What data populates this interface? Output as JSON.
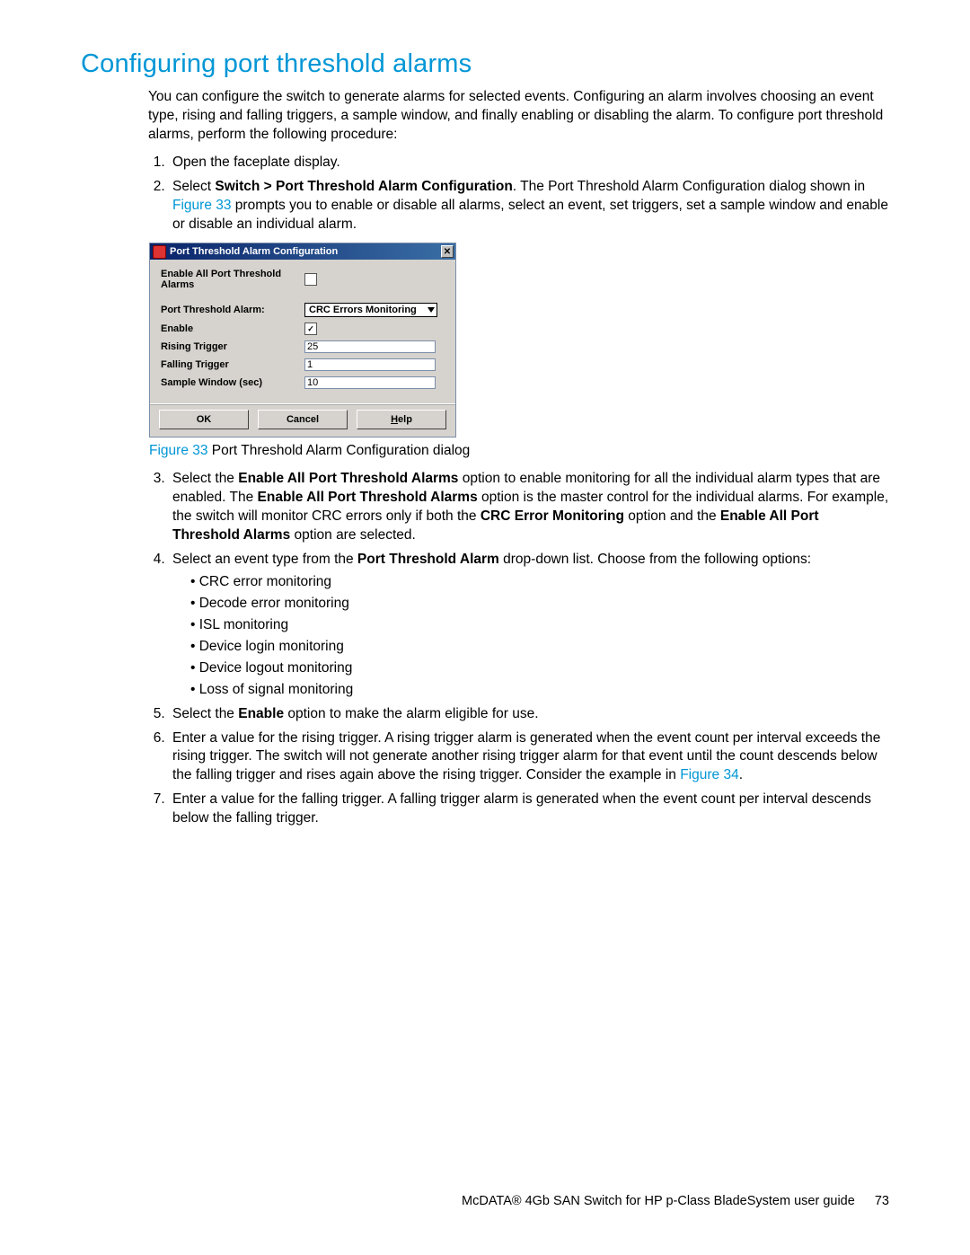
{
  "heading": "Configuring port threshold alarms",
  "intro": "You can configure the switch to generate alarms for selected events. Configuring an alarm involves choosing an event type, rising and falling triggers, a sample window, and finally enabling or disabling the alarm. To configure port threshold alarms, perform the following procedure:",
  "steps": {
    "s1": "Open the faceplate display.",
    "s2a": "Select ",
    "s2b": "Switch > Port Threshold Alarm Configuration",
    "s2c": ". The Port Threshold Alarm Configuration dialog shown in ",
    "s2d": "Figure 33",
    "s2e": " prompts you to enable or disable all alarms, select an event, set triggers, set a sample window and enable or disable an individual alarm.",
    "s3a": "Select the ",
    "s3b": "Enable All Port Threshold Alarms",
    "s3c": " option to enable monitoring for all the individual alarm types that are enabled. The ",
    "s3d": "Enable All Port Threshold Alarms",
    "s3e": " option is the master control for the individual alarms. For example, the switch will monitor CRC errors only if both the ",
    "s3f": "CRC Error Monitoring",
    "s3g": " option and the ",
    "s3h": "Enable All Port Threshold Alarms",
    "s3i": " option are selected.",
    "s4a": "Select an event type from the ",
    "s4b": "Port Threshold Alarm",
    "s4c": " drop-down list. Choose from the following options:",
    "opt1": "CRC error monitoring",
    "opt2": "Decode error monitoring",
    "opt3": "ISL monitoring",
    "opt4": "Device login monitoring",
    "opt5": "Device logout monitoring",
    "opt6": "Loss of signal monitoring",
    "s5a": "Select the ",
    "s5b": "Enable",
    "s5c": " option to make the alarm eligible for use.",
    "s6a": "Enter a value for the rising trigger. A rising trigger alarm is generated when the event count per interval exceeds the rising trigger. The switch will not generate another rising trigger alarm for that event until the count descends below the falling trigger and rises again above the rising trigger. Consider the example in ",
    "s6b": "Figure 34",
    "s6c": ".",
    "s7": "Enter a value for the falling trigger. A falling trigger alarm is generated when the event count per interval descends below the falling trigger."
  },
  "dialog": {
    "title": "Port Threshold Alarm Configuration",
    "enableAllLabel": "Enable All Port Threshold Alarms",
    "fields": {
      "pta": "Port Threshold Alarm:",
      "enable": "Enable",
      "rising": "Rising Trigger",
      "falling": "Falling Trigger",
      "sample": "Sample Window (sec)"
    },
    "values": {
      "ptaSelected": "CRC Errors Monitoring",
      "enableChecked": "✓",
      "rising": "25",
      "falling": "1",
      "sample": "10"
    },
    "buttons": {
      "ok": "OK",
      "cancel": "Cancel",
      "helpPre": "H",
      "helpRest": "elp"
    }
  },
  "figcap": {
    "num": "Figure 33",
    "text": " Port Threshold Alarm Configuration dialog"
  },
  "footer": {
    "text": "McDATA® 4Gb SAN Switch for HP p-Class BladeSystem user guide",
    "page": "73"
  }
}
